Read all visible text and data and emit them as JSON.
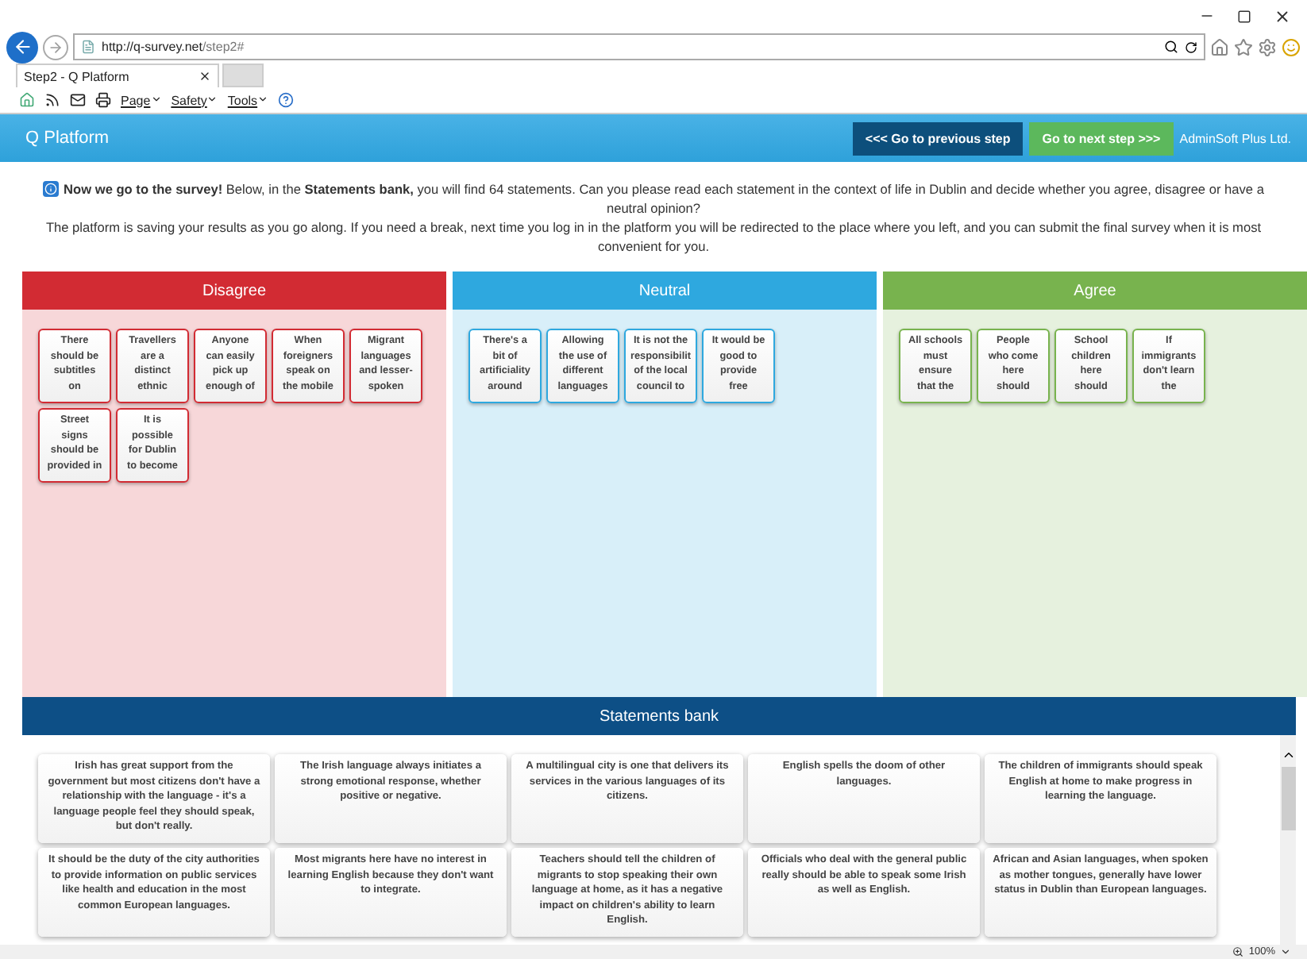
{
  "browser": {
    "url_host": "http://q-survey.net",
    "url_path": "/step2#",
    "tab_title": "Step2 - Q Platform",
    "menus": [
      "Page",
      "Safety",
      "Tools"
    ],
    "zoom": "100%"
  },
  "header": {
    "title": "Q Platform",
    "prev_button": "<<< Go to previous step",
    "next_button": "Go to next step >>>",
    "company": "AdminSoft Plus Ltd."
  },
  "intro": {
    "first": "**Now we go to the survey!** Below, in the **Statements bank,** you will find 64 statements. Can you please read each statement in the context of life in Dublin and decide whether you agree, disagree or have a neutral opinion?",
    "second": "The platform is saving your results as you go along. If you need a break, next time you log in in the platform you will be redirected to the place where you left, and you can submit the final survey when it is most convenient for you."
  },
  "columns": [
    {
      "title": "Disagree",
      "color": "#d22b33",
      "cards": [
        {
          "lines": [
            "There",
            "should be",
            "subtitles",
            "on"
          ]
        },
        {
          "lines": [
            "Travellers",
            "are a",
            "distinct",
            "ethnic"
          ]
        },
        {
          "lines": [
            "Anyone",
            "can easily",
            "pick up",
            "enough of"
          ]
        },
        {
          "lines": [
            "When",
            "foreigners",
            "speak on",
            "the mobile"
          ]
        },
        {
          "lines": [
            "Migrant",
            "languages",
            "and lesser-",
            "spoken"
          ]
        },
        {
          "lines": [
            "Street",
            "signs",
            "should be",
            "provided in"
          ]
        },
        {
          "lines": [
            "It is",
            "possible",
            "for Dublin",
            "to become"
          ]
        }
      ]
    },
    {
      "title": "Neutral",
      "color": "#2ea8df",
      "cards": [
        {
          "lines": [
            "There's a",
            "bit of",
            "artificiality",
            "around"
          ]
        },
        {
          "lines": [
            "Allowing",
            "the use of",
            "different",
            "languages"
          ]
        },
        {
          "lines": [
            "It is not the",
            "responsibilit",
            "of the local",
            "council to"
          ]
        },
        {
          "lines": [
            "It would be",
            "good to",
            "provide",
            "free"
          ]
        }
      ]
    },
    {
      "title": "Agree",
      "color": "#78b34e",
      "cards": [
        {
          "lines": [
            "All schools",
            "must",
            "ensure",
            "that the"
          ]
        },
        {
          "lines": [
            "People",
            "who come",
            "here",
            "should"
          ]
        },
        {
          "lines": [
            "School",
            "children",
            "here",
            "should"
          ]
        },
        {
          "lines": [
            "If",
            "immigrants",
            "don't learn",
            "the"
          ]
        }
      ]
    }
  ],
  "bank": {
    "title": "Statements bank",
    "statements": [
      "Irish has great support from the government but most citizens don't have a relationship with the language - it's a language people feel they should speak, but don't really.",
      "The Irish language always initiates a strong emotional response, whether positive or negative.",
      "A multilingual city is one that delivers its services in the various languages of its citizens.",
      "English spells the doom of other languages.",
      "The children of immigrants should speak English at home to make progress in learning the language.",
      "It should be the duty of the city authorities to provide information on public services like health and education in the most common European languages.",
      "Most migrants here have no interest in learning English because they don't want to integrate.",
      "Teachers should tell the children of migrants to stop speaking their own language at home, as it has a negative impact on children's ability to learn English.",
      "Officials who deal with the general public really should be able to speak some Irish as well as English.",
      "African and Asian languages, when spoken as mother tongues, generally have lower status in Dublin than European languages."
    ]
  }
}
